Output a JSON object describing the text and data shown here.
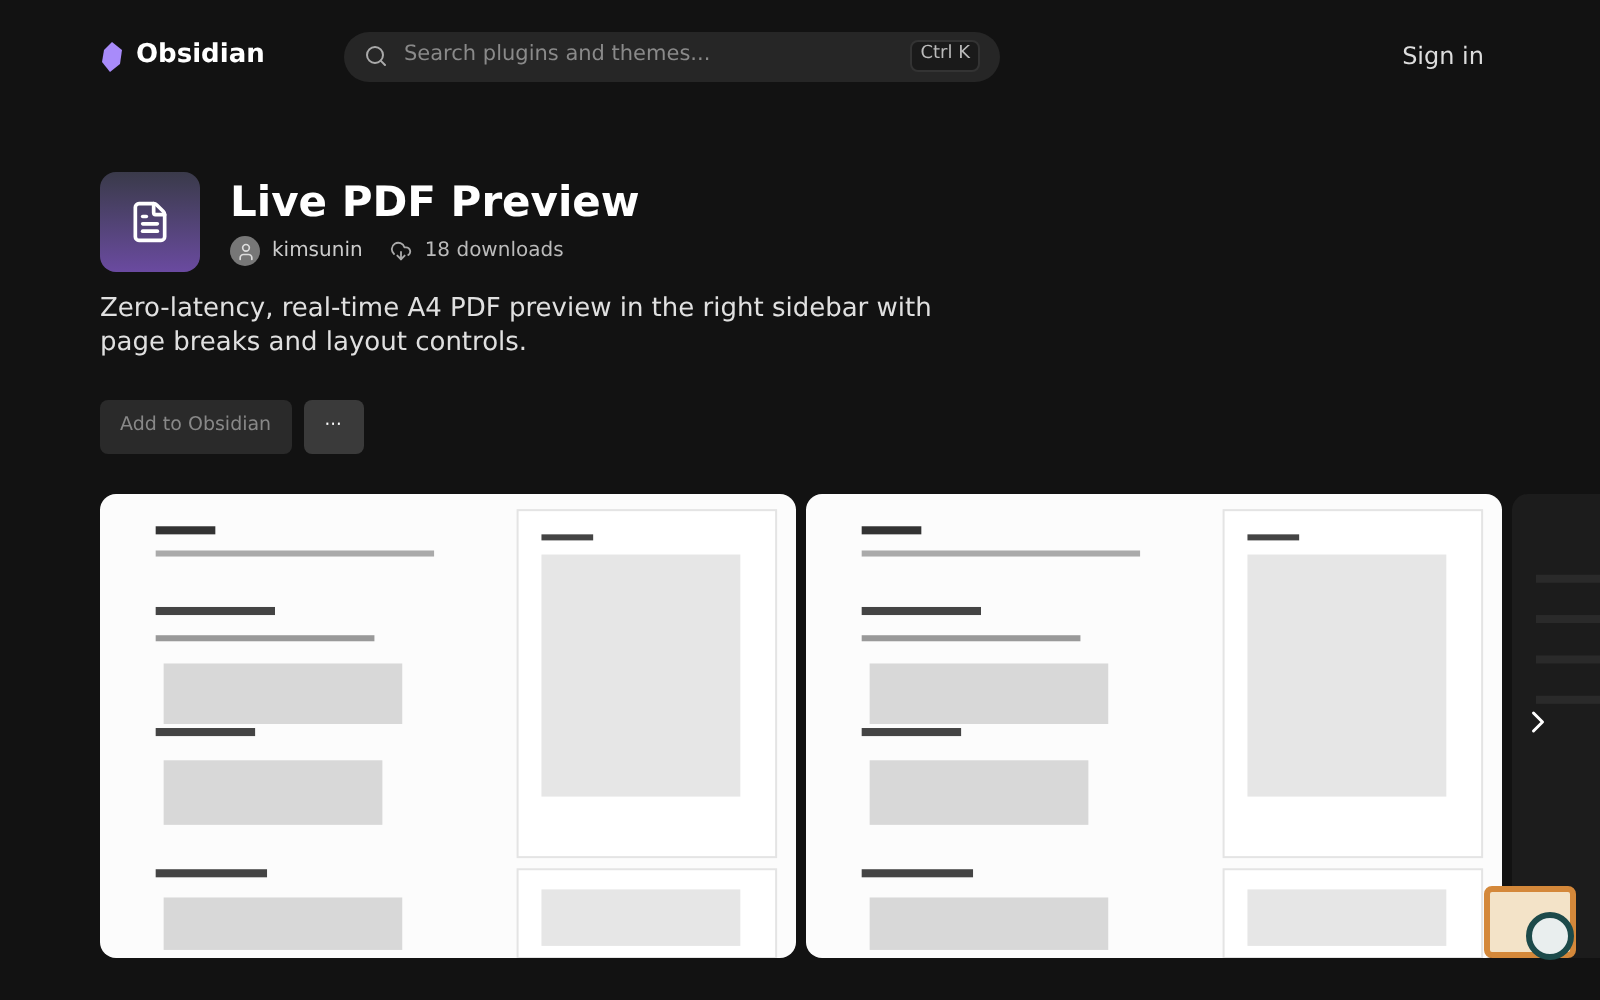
{
  "header": {
    "brand": "Obsidian",
    "search": {
      "placeholder": "Search plugins and themes...",
      "shortcut": "Ctrl K"
    },
    "sign_in": "Sign in"
  },
  "plugin": {
    "title": "Live PDF Preview",
    "author": "kimsunin",
    "downloads": "18 downloads",
    "description": "Zero-latency, real-time A4 PDF preview in the right sidebar with page breaks and layout controls.",
    "buttons": {
      "add": "Add to Obsidian",
      "more": "···"
    }
  }
}
